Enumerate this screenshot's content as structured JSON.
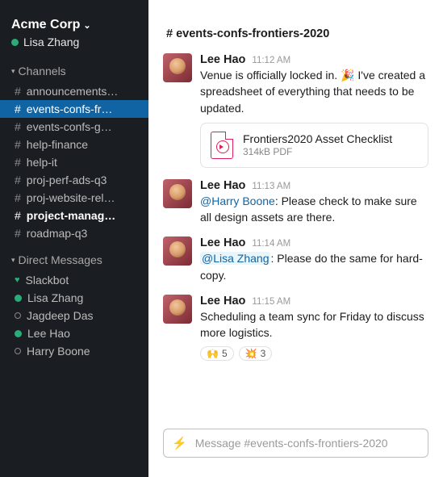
{
  "workspace": {
    "name": "Acme Corp",
    "user": "Lisa Zhang"
  },
  "sidebar": {
    "channels_title": "Channels",
    "dms_title": "Direct Messages",
    "channels": [
      {
        "label": "announcements…"
      },
      {
        "label": "events-confs-fr…"
      },
      {
        "label": "events-confs-g…"
      },
      {
        "label": "help-finance"
      },
      {
        "label": "help-it"
      },
      {
        "label": "proj-perf-ads-q3"
      },
      {
        "label": "proj-website-rel…"
      },
      {
        "label": "project-manag…"
      },
      {
        "label": "roadmap-q3"
      }
    ],
    "dms": [
      {
        "label": "Slackbot",
        "status": "heart"
      },
      {
        "label": "Lisa Zhang",
        "status": "online"
      },
      {
        "label": "Jagdeep Das",
        "status": "offline"
      },
      {
        "label": "Lee Hao",
        "status": "online"
      },
      {
        "label": "Harry Boone",
        "status": "offline"
      }
    ]
  },
  "channel": {
    "header": "# events-confs-frontiers-2020"
  },
  "messages": [
    {
      "sender": "Lee Hao",
      "time": "11:12 AM",
      "text_pre": "Venue is officially locked in. ",
      "emoji": "🎉",
      "text_post": " I've created a spreadsheet of everything that needs to be updated.",
      "attachment": {
        "title": "Frontiers2020 Asset Checklist",
        "meta": "314kB PDF"
      }
    },
    {
      "sender": "Lee Hao",
      "time": "11:13 AM",
      "mention": "@Harry Boone",
      "text_post": ": Please check to make sure all design assets are there."
    },
    {
      "sender": "Lee Hao",
      "time": "11:14 AM",
      "mention": "@Lisa Zhang",
      "text_post": ": Please do the same for hard-copy."
    },
    {
      "sender": "Lee Hao",
      "time": "11:15 AM",
      "text_pre": "Scheduling a team sync for Friday to discuss more logistics.",
      "reactions": [
        {
          "emoji": "🙌",
          "count": "5"
        },
        {
          "emoji": "💥",
          "count": "3"
        }
      ]
    }
  ],
  "composer": {
    "placeholder": "Message #events-confs-frontiers-2020"
  }
}
